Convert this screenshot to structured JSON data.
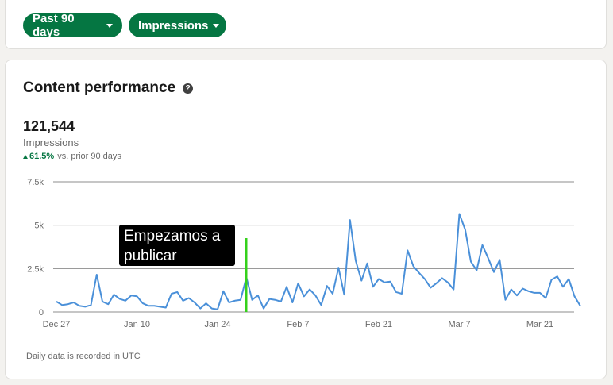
{
  "filters": {
    "range_label": "Past 90 days",
    "metric_label": "Impressions"
  },
  "card": {
    "title": "Content performance",
    "total_value": "121,544",
    "total_label": "Impressions",
    "trend_value": "61.5%",
    "trend_text": "vs. prior 90 days",
    "footnote": "Daily data is recorded in UTC"
  },
  "annotation": {
    "text_line1": "Empezamos a",
    "text_line2": "publicar"
  },
  "colors": {
    "accent": "#057642",
    "line": "#4a90d9",
    "marker": "#35d11c",
    "grid": "#8c8c8c"
  },
  "chart_data": {
    "type": "line",
    "title": "",
    "xlabel": "",
    "ylabel": "",
    "ylim": [
      0,
      7500
    ],
    "y_ticks": [
      0,
      2500,
      5000,
      7500
    ],
    "y_tick_labels": [
      "0",
      "2.5k",
      "5k",
      "7.5k"
    ],
    "x_ticks": [
      0,
      14,
      28,
      42,
      56,
      70,
      84
    ],
    "x_tick_labels": [
      "Dec 27",
      "Jan 10",
      "Jan 24",
      "Feb 7",
      "Feb 21",
      "Mar 7",
      "Mar 21"
    ],
    "marker_day": 33,
    "legend": "none",
    "grid": true,
    "series": [
      {
        "values": [
          600,
          400,
          450,
          550,
          350,
          300,
          400,
          2150,
          600,
          450,
          1000,
          750,
          650,
          950,
          900,
          500,
          350,
          350,
          300,
          250,
          1050,
          1150,
          650,
          800,
          550,
          200,
          500,
          200,
          150,
          1200,
          550,
          650,
          700,
          2000,
          700,
          950,
          200,
          750,
          700,
          600,
          1450,
          550,
          1650,
          900,
          1300,
          950,
          400,
          1500,
          1050,
          2550,
          1000,
          5300,
          2950,
          1800,
          2800,
          1450,
          1900,
          1700,
          1750,
          1150,
          1050,
          3550,
          2650,
          2250,
          1900,
          1400,
          1650,
          1950,
          1700,
          1300,
          5650,
          4750,
          2900,
          2400,
          3850,
          3100,
          2300,
          3000,
          700,
          1300,
          950,
          1350,
          1200,
          1100,
          1100,
          800,
          1850,
          2050,
          1450,
          1900,
          900,
          350
        ]
      }
    ]
  }
}
